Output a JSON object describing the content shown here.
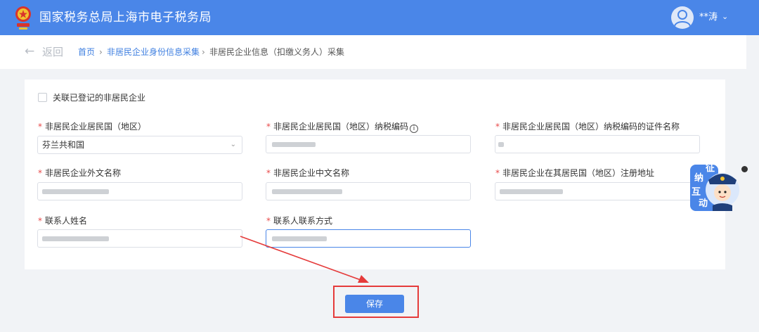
{
  "header": {
    "site_title": "国家税务总局上海市电子税务局",
    "username": "**涛",
    "user_menu_caret": "⌄"
  },
  "breadcrumb": {
    "back_arrow": "←",
    "back_label": "返回",
    "items": [
      "首页",
      "非居民企业身份信息采集",
      "非居民企业信息（扣缴义务人）采集"
    ],
    "separator": "›"
  },
  "form": {
    "link_checkbox_label": "关联已登记的非居民企业",
    "required_mark": "*",
    "fields": {
      "country": {
        "label": "非居民企业居民国（地区）",
        "value": "芬兰共和国"
      },
      "tax_number": {
        "label": "非居民企业居民国（地区）纳税编码"
      },
      "tax_cert_name": {
        "label": "非居民企业居民国（地区）纳税编码的证件名称"
      },
      "foreign_name": {
        "label": "非居民企业外文名称"
      },
      "chinese_name": {
        "label": "非居民企业中文名称"
      },
      "registered_address": {
        "label": "非居民企业在其居民国（地区）注册地址"
      },
      "contact_name": {
        "label": "联系人姓名"
      },
      "contact_phone": {
        "label": "联系人联系方式"
      }
    },
    "info_icon_glyph": "i",
    "select_caret": "⌄",
    "save_label": "保存"
  },
  "mascot": {
    "chars": [
      "征",
      "纳",
      "互",
      "动"
    ]
  },
  "colors": {
    "header_bg": "#4a86e8",
    "link": "#3f7fe0",
    "required": "#e84a4a",
    "primary_button": "#4a86e8",
    "annotation_red": "#e53b3b"
  },
  "icons": [
    "tax-emblem-icon",
    "user-avatar-icon",
    "back-arrow-icon",
    "info-icon",
    "chevron-down-icon",
    "close-icon"
  ]
}
